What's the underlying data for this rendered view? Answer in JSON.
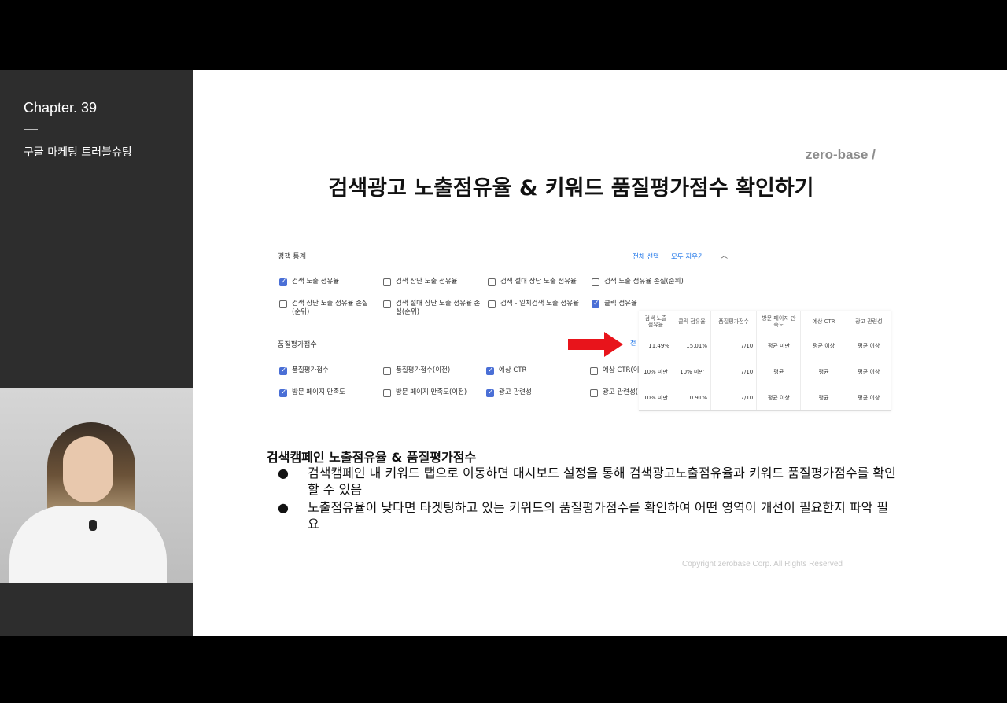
{
  "sidebar": {
    "chapter": "Chapter. 39",
    "subtitle": "구글 마케팅 트러블슈팅"
  },
  "slide": {
    "logo": "zero-base /",
    "title": "검색광고 노출점유율 & 키워드 품질평가점수 확인하기",
    "copyright": "Copyright zerobase Corp. All Rights Reserved"
  },
  "screenshot": {
    "section1_title": "경쟁 통계",
    "select_all": "전체 선택",
    "clear_all": "모두 지우기",
    "section1_items": [
      {
        "label": "검색 노출 점유율",
        "checked": true
      },
      {
        "label": "검색 상단 노출 점유율",
        "checked": false
      },
      {
        "label": "검색 절대 상단 노출 점유율",
        "checked": false
      },
      {
        "label": "검색 노출 점유율 손실(순위)",
        "checked": false
      },
      {
        "label": "검색 상단 노출 점유율 손실(순위)",
        "checked": false
      },
      {
        "label": "검색 절대 상단 노출 점유율 손실(순위)",
        "checked": false
      },
      {
        "label": "검색 - 일치검색 노출 점유율",
        "checked": false
      },
      {
        "label": "클릭 점유율",
        "checked": true
      }
    ],
    "section2_title": "품질평가점수",
    "section2_items": [
      {
        "label": "품질평가점수",
        "checked": true
      },
      {
        "label": "품질평가점수(이전)",
        "checked": false
      },
      {
        "label": "예상 CTR",
        "checked": true
      },
      {
        "label": "예상 CTR(이",
        "checked": false
      },
      {
        "label": "방문 페이지 만족도",
        "checked": true
      },
      {
        "label": "방문 페이지 만족도(이전)",
        "checked": false
      },
      {
        "label": "광고 관련성",
        "checked": true
      },
      {
        "label": "광고 관련성(",
        "checked": false
      }
    ],
    "peek_text": "전",
    "table": {
      "headers": [
        "검색 노출 점유율",
        "클릭 점유율",
        "품질평가점수",
        "방문 페이지 만족도",
        "예상 CTR",
        "광고 관련성"
      ],
      "rows": [
        [
          "11.49%",
          "15.01%",
          "7/10",
          "평균 미만",
          "평균 이상",
          "평균 이상"
        ],
        [
          "10% 미만",
          "10% 미만",
          "7/10",
          "평균",
          "평균",
          "평균 이상"
        ],
        [
          "10% 미만",
          "10.91%",
          "7/10",
          "평균 이상",
          "평균",
          "평균 이상"
        ]
      ]
    },
    "arrow_color": "#e8141b"
  },
  "body": {
    "heading": "검색캠페인 노출점유율 & 품질평가점수",
    "bullets": [
      "검색캠페인 내 키워드 탭으로 이동하면 대시보드 설정을 통해 검색광고노출점유율과 키워드 품질평가점수를 확인할 수 있음",
      "노출점유율이 낮다면 타겟팅하고 있는 키워드의 품질평가점수를 확인하여 어떤 영역이 개선이 필요한지 파악 필요"
    ]
  }
}
